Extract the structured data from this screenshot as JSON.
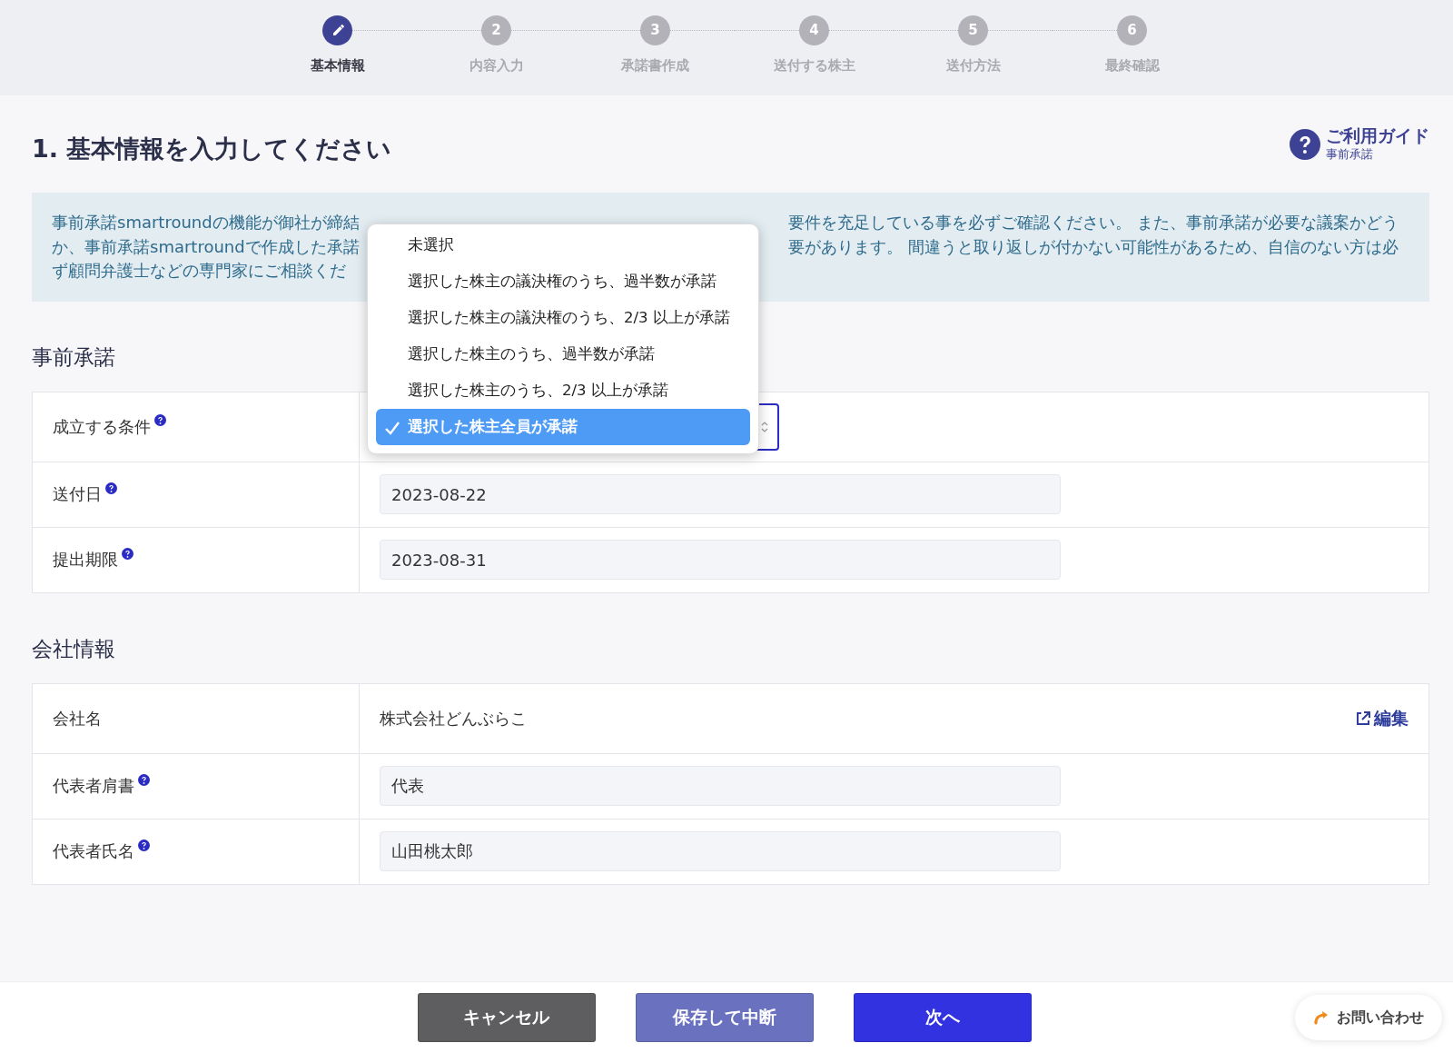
{
  "stepper": [
    {
      "label": "基本情報",
      "current": true
    },
    {
      "label": "内容入力",
      "number": "2",
      "current": false
    },
    {
      "label": "承諾書作成",
      "number": "3",
      "current": false
    },
    {
      "label": "送付する株主",
      "number": "4",
      "current": false
    },
    {
      "label": "送付方法",
      "number": "5",
      "current": false
    },
    {
      "label": "最終確認",
      "number": "6",
      "current": false
    }
  ],
  "page_title": "1. 基本情報を入力してください",
  "guide": {
    "title": "ご利用ガイド",
    "subtitle": "事前承諾"
  },
  "notice": {
    "lines": [
      {
        "left": "事前承諾smartroundの機能が御社が締結",
        "right": "要件を充足している事を必ずご確認ください。 また、事前承諾が必要な議案かどう"
      },
      {
        "left": "か、事前承諾smartroundで作成した承諾",
        "right": "要があります。 間違うと取り返しが付かない可能性があるため、自信のない方は必"
      },
      {
        "left": "ず顧問弁護士などの専門家にご相談くだ"
      }
    ]
  },
  "sections": [
    {
      "heading": "事前承諾",
      "rows": [
        {
          "label": "成立する条件",
          "help": true,
          "kind": "select"
        },
        {
          "label": "送付日",
          "help": true,
          "kind": "input",
          "value": "2023-08-22"
        },
        {
          "label": "提出期限",
          "help": true,
          "kind": "input",
          "value": "2023-08-31"
        }
      ]
    },
    {
      "heading": "会社情報",
      "rows": [
        {
          "label": "会社名",
          "help": false,
          "kind": "static",
          "value": "株式会社どんぶらこ",
          "link": "編集"
        },
        {
          "label": "代表者肩書",
          "help": true,
          "kind": "input",
          "value": "代表"
        },
        {
          "label": "代表者氏名",
          "help": true,
          "kind": "input",
          "value": "山田桃太郎"
        }
      ]
    }
  ],
  "dropdown": {
    "options": [
      {
        "label": "未選択",
        "selected": false
      },
      {
        "label": "選択した株主の議決権のうち、過半数が承諾",
        "selected": false
      },
      {
        "label": "選択した株主の議決権のうち、2/3 以上が承諾",
        "selected": false
      },
      {
        "label": "選択した株主のうち、過半数が承諾",
        "selected": false
      },
      {
        "label": "選択した株主のうち、2/3 以上が承諾",
        "selected": false
      },
      {
        "label": "選択した株主全員が承諾",
        "selected": true
      }
    ]
  },
  "footer": {
    "buttons": [
      {
        "label": "キャンセル",
        "kind": "cancel"
      },
      {
        "label": "保存して中断",
        "kind": "save"
      },
      {
        "label": "次へ",
        "kind": "next"
      }
    ],
    "contact": "お問い合わせ"
  }
}
